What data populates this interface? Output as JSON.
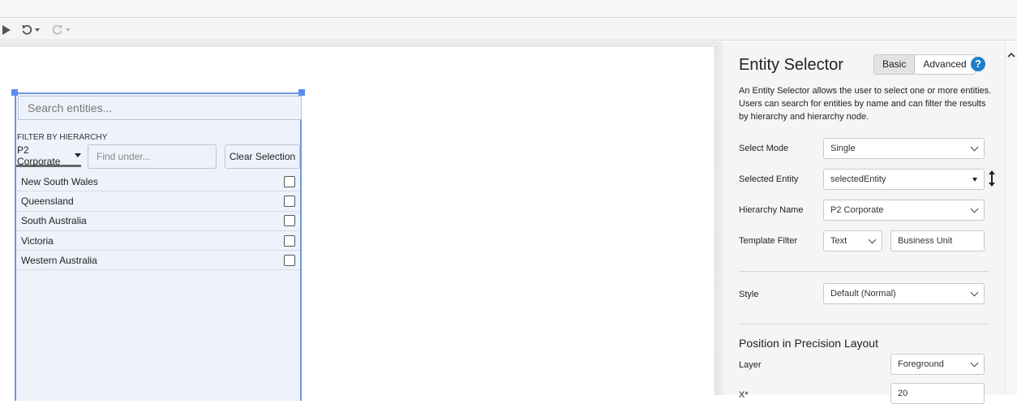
{
  "toolbar": {
    "play_icon": "play-icon",
    "undo_icon": "undo-icon",
    "redo_icon": "redo-icon"
  },
  "widget": {
    "search_placeholder": "Search entities...",
    "filter_label": "FILTER BY HIERARCHY",
    "hierarchy_value": "P2 Corporate",
    "find_placeholder": "Find under...",
    "clear_label": "Clear Selection",
    "items": [
      {
        "label": "New South Wales",
        "checked": false
      },
      {
        "label": "Queensland",
        "checked": false
      },
      {
        "label": "South Australia",
        "checked": false
      },
      {
        "label": "Victoria",
        "checked": false
      },
      {
        "label": "Western Australia",
        "checked": false
      }
    ]
  },
  "panel": {
    "title": "Entity Selector",
    "tabs": [
      "Basic",
      "Advanced"
    ],
    "active_tab": "Basic",
    "help": "?",
    "description": "An Entity Selector allows the user to select one or more entities. Users can search for entities by name and can filter the results by hierarchy and hierarchy node.",
    "fields": {
      "select_mode_label": "Select Mode",
      "select_mode_value": "Single",
      "selected_entity_label": "Selected Entity",
      "selected_entity_value": "selectedEntity",
      "hierarchy_name_label": "Hierarchy Name",
      "hierarchy_name_value": "P2 Corporate",
      "template_filter_label": "Template Filter",
      "template_filter_type": "Text",
      "template_filter_value": "Business Unit",
      "style_label": "Style",
      "style_value": "Default (Normal)"
    },
    "position_section": "Position in Precision Layout",
    "layer_label": "Layer",
    "layer_value": "Foreground",
    "x_label": "X*",
    "x_value": "20"
  },
  "colors": {
    "accent": "#1f7ec7",
    "selection": "#6f97e3",
    "widget_bg": "#eef2fb"
  }
}
